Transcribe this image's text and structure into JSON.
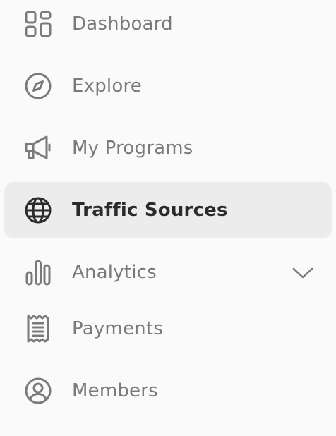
{
  "sidebar": {
    "items": [
      {
        "label": "Dashboard",
        "icon": "dashboard-grid-icon"
      },
      {
        "label": "Explore",
        "icon": "compass-icon"
      },
      {
        "label": "My Programs",
        "icon": "megaphone-icon"
      },
      {
        "label": "Traffic Sources",
        "icon": "globe-icon",
        "active": true
      },
      {
        "label": "Analytics",
        "icon": "bar-chart-icon",
        "expandable": true
      },
      {
        "label": "Payments",
        "icon": "receipt-icon"
      },
      {
        "label": "Members",
        "icon": "user-circle-icon"
      }
    ]
  },
  "colors": {
    "background": "#fafafa",
    "active_background": "#ececec",
    "text": "#7a7a7a",
    "active_text": "#2b2b2b"
  }
}
